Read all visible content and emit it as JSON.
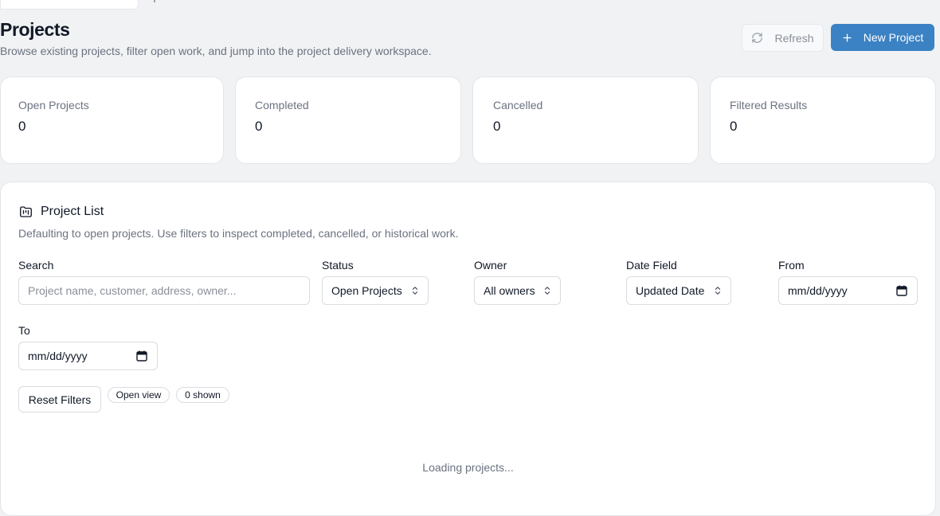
{
  "header": {
    "title": "Projects",
    "subtitle": "Browse existing projects, filter open work, and jump into the project delivery workspace.",
    "refresh_label": "Refresh",
    "new_project_label": "New Project"
  },
  "stats": [
    {
      "label": "Open Projects",
      "value": "0"
    },
    {
      "label": "Completed",
      "value": "0"
    },
    {
      "label": "Cancelled",
      "value": "0"
    },
    {
      "label": "Filtered Results",
      "value": "0"
    }
  ],
  "project_list": {
    "title": "Project List",
    "description": "Defaulting to open projects. Use filters to inspect completed, cancelled, or historical work.",
    "filters": {
      "search": {
        "label": "Search",
        "placeholder": "Project name, customer, address, owner..."
      },
      "status": {
        "label": "Status",
        "value": "Open Projects"
      },
      "owner": {
        "label": "Owner",
        "value": "All owners"
      },
      "date_field": {
        "label": "Date Field",
        "value": "Updated Date"
      },
      "from": {
        "label": "From",
        "value": "mm/dd/yyyy"
      },
      "to": {
        "label": "To",
        "value": "mm/dd/yyyy"
      }
    },
    "reset_label": "Reset Filters",
    "view_badge": "Open view",
    "count_badge": "0 shown",
    "loading_text": "Loading projects..."
  },
  "colors": {
    "primary": "#3b82c4",
    "page_background": "#f1f2f3",
    "card_background": "#ffffff",
    "muted_text": "#6b7280"
  },
  "icons": {
    "refresh": "refresh-icon",
    "new_project": "plus-icon",
    "project_list": "folder-kanban-icon",
    "select": "chevron-up-down-icon",
    "date": "calendar-icon"
  }
}
